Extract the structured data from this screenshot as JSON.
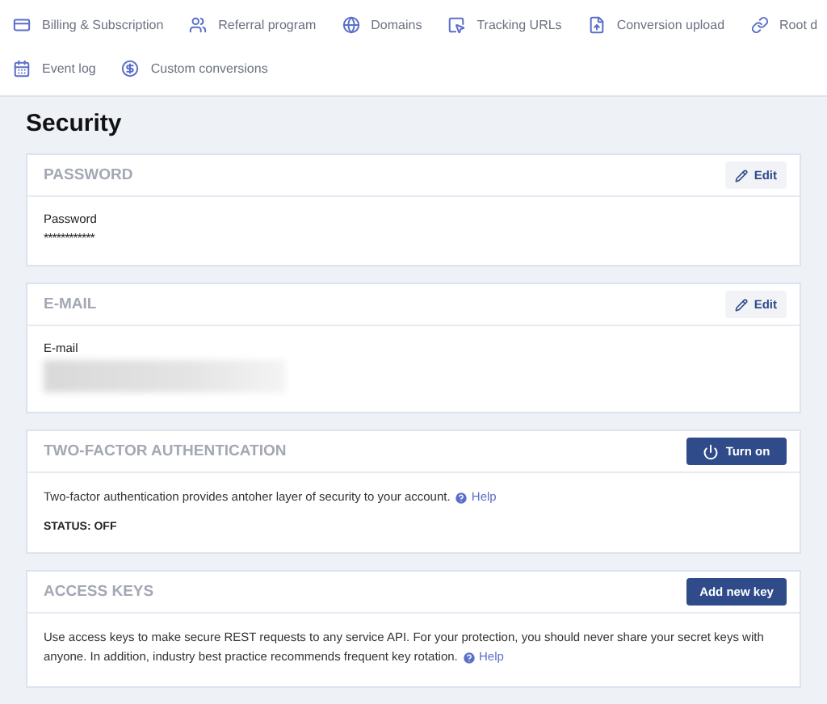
{
  "nav_rows": [
    [
      {
        "label": "Billing & Subscription"
      },
      {
        "label": "Referral program"
      },
      {
        "label": "Domains"
      },
      {
        "label": "Tracking URLs"
      },
      {
        "label": "Conversion upload"
      },
      {
        "label": "Root d"
      }
    ],
    [
      {
        "label": "Event log"
      },
      {
        "label": "Custom conversions"
      }
    ]
  ],
  "page_title": "Security",
  "sections": [
    {
      "kind": "credential",
      "title": "PASSWORD",
      "button": "Edit",
      "field_label": "Password",
      "value": "************"
    },
    {
      "kind": "credential",
      "title": "E-MAIL",
      "button": "Edit",
      "field_label": "E-mail",
      "redacted": true
    },
    {
      "kind": "info",
      "title": "TWO-FACTOR AUTHENTICATION",
      "button": "Turn on",
      "description": "Two-factor authentication provides antoher layer of security to your account.",
      "help": "Help",
      "status": "STATUS: OFF"
    },
    {
      "kind": "info",
      "title": "ACCESS KEYS",
      "button": "Add new key",
      "description": "Use access keys to make secure REST requests to any service API. For your protection, you should never share your secret keys with anyone. In addition, industry best practice recommends frequent key rotation.",
      "help": "Help"
    }
  ]
}
